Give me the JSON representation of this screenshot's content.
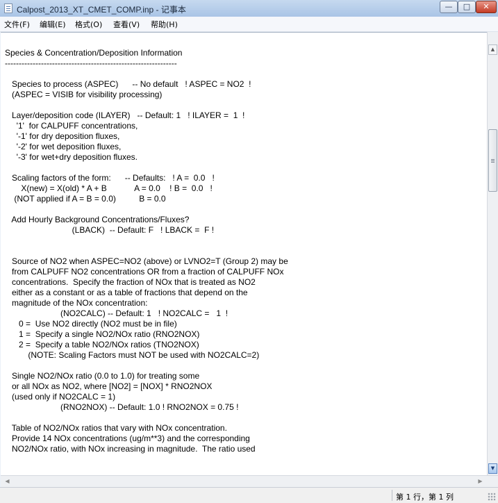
{
  "window": {
    "title": "Calpost_2013_XT_CMET_COMP.inp - 记事本",
    "min_glyph": "—",
    "max_glyph": "□",
    "close_glyph": "✕"
  },
  "menu": {
    "file": "文件(F)",
    "edit": "编辑(E)",
    "format": "格式(O)",
    "view": "查看(V)",
    "help": "帮助(H)"
  },
  "editor": {
    "lines": [
      "Species & Concentration/Deposition Information",
      "--------------------------------------------------------------",
      "",
      "   Species to process (ASPEC)      -- No default   ! ASPEC = NO2  !",
      "   (ASPEC = VISIB for visibility processing)",
      "",
      "   Layer/deposition code (ILAYER)   -- Default: 1   ! ILAYER =  1  !",
      "     '1'  for CALPUFF concentrations,",
      "     '-1' for dry deposition fluxes,",
      "     '-2' for wet deposition fluxes,",
      "     '-3' for wet+dry deposition fluxes.",
      "",
      "   Scaling factors of the form:      -- Defaults:   ! A =  0.0   !",
      "       X(new) = X(old) * A + B            A = 0.0    ! B =  0.0   !",
      "    (NOT applied if A = B = 0.0)          B = 0.0",
      "",
      "   Add Hourly Background Concentrations/Fluxes?",
      "                             (LBACK)  -- Default: F   ! LBACK =  F !",
      "",
      "",
      "   Source of NO2 when ASPEC=NO2 (above) or LVNO2=T (Group 2) may be",
      "   from CALPUFF NO2 concentrations OR from a fraction of CALPUFF NOx",
      "   concentrations.  Specify the fraction of NOx that is treated as NO2",
      "   either as a constant or as a table of fractions that depend on the",
      "   magnitude of the NOx concentration:",
      "                        (NO2CALC) -- Default: 1   ! NO2CALC =   1  !",
      "      0 =  Use NO2 directly (NO2 must be in file)",
      "      1 =  Specify a single NO2/NOx ratio (RNO2NOX)",
      "      2 =  Specify a table NO2/NOx ratios (TNO2NOX)",
      "          (NOTE: Scaling Factors must NOT be used with NO2CALC=2)",
      "",
      "   Single NO2/NOx ratio (0.0 to 1.0) for treating some",
      "   or all NOx as NO2, where [NO2] = [NOX] * RNO2NOX",
      "   (used only if NO2CALC = 1)",
      "                        (RNO2NOX) -- Default: 1.0 ! RNO2NOX = 0.75 !",
      "",
      "   Table of NO2/NOx ratios that vary with NOx concentration.",
      "   Provide 14 NOx concentrations (ug/m**3) and the corresponding",
      "   NO2/NOx ratio, with NOx increasing in magnitude.  The ratio used"
    ]
  },
  "scroll": {
    "up_glyph": "▲",
    "down_glyph": "▼",
    "left_glyph": "◀",
    "right_glyph": "▶"
  },
  "status": {
    "position": "第 1 行，第 1 列"
  }
}
